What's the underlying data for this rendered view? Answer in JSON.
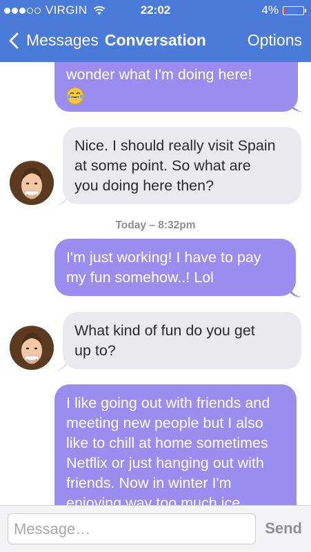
{
  "status_bar": {
    "signal_bars_filled": 3,
    "signal_bars_total": 5,
    "carrier": "VIRGIN",
    "time": "22:02",
    "battery_percent": "4%",
    "battery_level": 0.04,
    "battery_color": "#ff3b30"
  },
  "nav": {
    "back_label": "Messages",
    "title": "Conversation",
    "options_label": "Options",
    "back_icon": "chevron-left-icon",
    "bar_color": "#4a7bd9"
  },
  "thread": {
    "messages": [
      {
        "direction": "outgoing",
        "lines": [
          "wonder what I'm doing here!"
        ],
        "emoji": "face-with-tears-of-joy"
      },
      {
        "direction": "incoming",
        "lines": [
          "Nice. I should really visit Spain",
          "at some point. So what are",
          "you doing here then?"
        ]
      },
      {
        "direction": "outgoing",
        "lines": [
          "I'm just working! I have to pay",
          "my fun somehow..! Lol"
        ]
      },
      {
        "direction": "incoming",
        "lines": [
          "What kind of fun do you get",
          "up to?"
        ]
      },
      {
        "direction": "outgoing",
        "lines": [
          "I like going out with friends and",
          "meeting new people but I also",
          "like to chill at home sometimes",
          "Netflix or just hanging out with",
          "friends. Now in winter I'm",
          "enjoying way too much ice"
        ]
      }
    ],
    "timestamp": {
      "day": "Today",
      "separator": " – ",
      "time": "8:32pm"
    },
    "outgoing_color": "#9b8df0",
    "incoming_color": "#e9e9ee"
  },
  "composer": {
    "placeholder": "Message…",
    "value": "",
    "send_label": "Send"
  }
}
